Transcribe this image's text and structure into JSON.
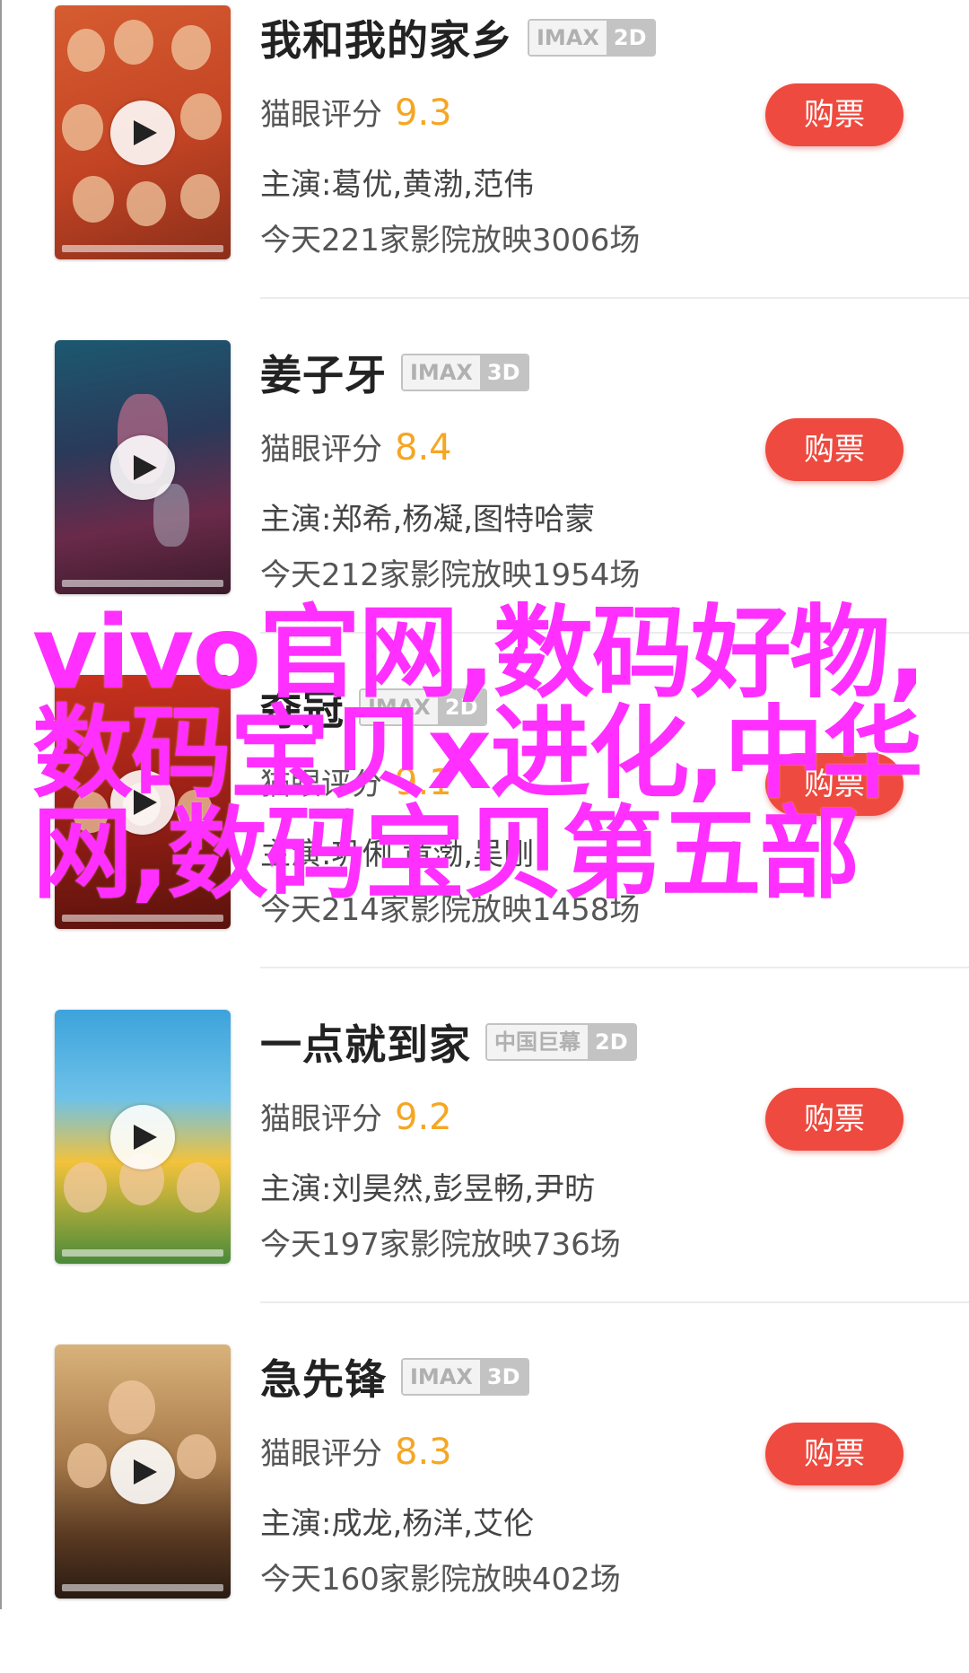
{
  "movies": [
    {
      "title": "我和我的家乡",
      "badge_left": "IMAX",
      "badge_right": "2D",
      "score_label": "猫眼评分",
      "score": "9.3",
      "cast": "主演:葛优,黄渤,范伟",
      "shows": "今天221家影院放映3006场",
      "buy_label": "购票",
      "poster_colors": [
        "#c8502a",
        "#e0713a",
        "#8a2e1a"
      ]
    },
    {
      "title": "姜子牙",
      "badge_left": "IMAX",
      "badge_right": "3D",
      "score_label": "猫眼评分",
      "score": "8.4",
      "cast": "主演:郑希,杨凝,图特哈蒙",
      "shows": "今天212家影院放映1954场",
      "buy_label": "购票",
      "poster_colors": [
        "#1f4a63",
        "#3a2b52",
        "#7a2d4a"
      ]
    },
    {
      "title": "夺冠",
      "badge_left": "IMAX",
      "badge_right": "2D",
      "score_label": "猫眼评分",
      "score": "9.1",
      "cast": "主演:巩俐,黄渤,吴刚",
      "shows": "今天214家影院放映1458场",
      "buy_label": "购票",
      "poster_colors": [
        "#b22a1e",
        "#7a1a12",
        "#d44a2a"
      ]
    },
    {
      "title": "一点就到家",
      "badge_left": "中国巨幕",
      "badge_right": "2D",
      "score_label": "猫眼评分",
      "score": "9.2",
      "cast": "主演:刘昊然,彭昱畅,尹昉",
      "shows": "今天197家影院放映736场",
      "buy_label": "购票",
      "poster_colors": [
        "#3aa0d8",
        "#f2c23a",
        "#4a8a3a"
      ]
    },
    {
      "title": "急先锋",
      "badge_left": "IMAX",
      "badge_right": "3D",
      "score_label": "猫眼评分",
      "score": "8.3",
      "cast": "主演:成龙,杨洋,艾伦",
      "shows": "今天160家影院放映402场",
      "buy_label": "购票",
      "poster_colors": [
        "#c9a06a",
        "#7a5a3a",
        "#3a2a1e"
      ]
    }
  ],
  "overlay_text": "vivo官网,数码好物,数码宝贝x进化,中华网,数码宝贝第五部",
  "colors": {
    "accent": "#ee4a3f",
    "score": "#f5a623",
    "overlay": "#ff2fff"
  },
  "icons": {
    "play": "play-icon"
  }
}
